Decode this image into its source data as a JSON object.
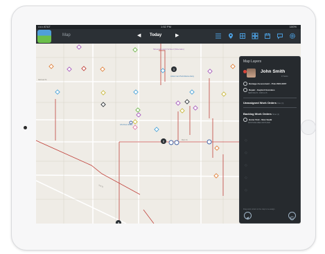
{
  "status_bar": {
    "carrier": "••••• AT&T ",
    "time": "1:52 PM",
    "battery": "100%"
  },
  "nav": {
    "title": "Map",
    "date_label": "Today",
    "prev_icon": "chevron-left-icon",
    "next_icon": "chevron-right-icon",
    "right_icons": [
      "list-icon",
      "pin-icon",
      "layers-icon",
      "grid-icon",
      "calendar-icon",
      "chat-icon",
      "gear-icon"
    ]
  },
  "map": {
    "labels": [
      "Silverado High School (Silverado)",
      "Ackerman Park Elementary",
      "Silverado Elementary",
      "US Post Office"
    ],
    "numbered_pins": [
      "1",
      "2",
      "3"
    ],
    "street_labels": [
      "Railroad St",
      "Main St",
      "2nd St"
    ]
  },
  "panel": {
    "title": "Map Layers",
    "user": {
      "name": "John Smith",
      "sub": "17 items"
    },
    "work_orders": [
      {
        "title": "Damage Assessment - Pole 2024-0307",
        "sub": ""
      },
      {
        "title": "Repair - Gaylord Gonzales",
        "sub": "SERVICE PL. 1829 & 15"
      }
    ],
    "unassigned": {
      "label": "Unassigned Work Orders",
      "small": "Filter (3)"
    },
    "backlog": {
      "label": "Backlog Work Orders",
      "small": "Show (1)"
    },
    "backlog_items": [
      {
        "title": "Home Visit - Stan Sealk",
        "sub": "PASTURE AREA 200712020"
      }
    ],
    "footer": "Drag work orders to the map to re-assign"
  },
  "colors": {
    "nav_bg": "#2b3035",
    "panel_bg": "#262a2e",
    "road": "#c0413a",
    "map_bg": "#efece6",
    "marker_orange": "#e0803a",
    "marker_purple": "#a65bbd",
    "marker_blue": "#4aa3d8",
    "marker_yellow": "#c9b83e",
    "marker_green": "#6fb64a",
    "marker_pink": "#e07aa8"
  }
}
